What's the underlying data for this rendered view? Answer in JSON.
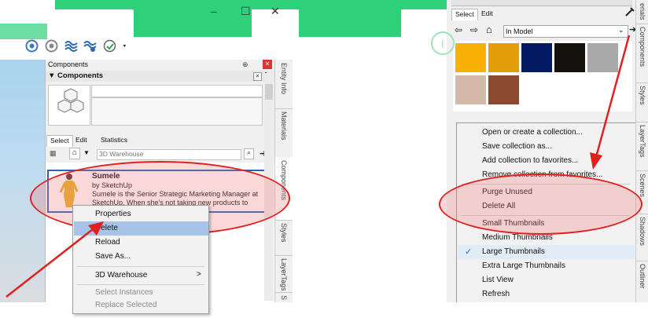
{
  "left": {
    "window_controls": {
      "minimize": "–",
      "maximize": "☐",
      "close": "✕"
    },
    "toolbar_icons": [
      "warehouse-icon",
      "warehouse-share-icon",
      "extension-icon",
      "extension-manager-icon",
      "profile-icon",
      "dropdown-arrow-icon"
    ],
    "tray": {
      "title": "Components",
      "pin": "⊕",
      "close": "✕",
      "section_title": "▼ Components",
      "tabs": [
        "Select",
        "Edit",
        "Statistics"
      ],
      "search_placeholder": "3D Warehouse",
      "component": {
        "name": "Sumele",
        "author": "by SketchUp",
        "description": "Sumele is the Senior Strategic Marketing Manager at SketchUp. When she's not taking new products to lau..."
      }
    },
    "side_tabs": [
      "Entity Info",
      "Materials",
      "Components",
      "Styles",
      "LayerTags",
      "S"
    ],
    "context_menu": {
      "items": [
        "Properties",
        "Delete",
        "Reload",
        "Save As...",
        "3D Warehouse",
        "Select Instances",
        "Replace Selected"
      ],
      "highlighted": "Delete",
      "submenu_arrow": ">"
    }
  },
  "right": {
    "tabs": [
      "Select",
      "Edit"
    ],
    "collection": "In Model",
    "swatch_colors": [
      "#f8b107",
      "#e39c0a",
      "#041a63",
      "#14100c",
      "#a9a9a9",
      "#d4b8a9",
      "#8b4a30"
    ],
    "menu_items": [
      "Open or create a collection...",
      "Save collection as...",
      "Add collection to favorites...",
      "Remove collection from favorites...",
      "Purge Unused",
      "Delete All",
      "Small Thumbnails",
      "Medium Thumbnails",
      "Large Thumbnails",
      "Extra Large Thumbnails",
      "List View",
      "Refresh"
    ],
    "checked_item": "Large Thumbnails",
    "side_tabs": [
      "erials",
      "Components",
      "Styles",
      "LayerTags",
      "Scenes",
      "Shadows",
      "Outliner"
    ]
  },
  "annotation_color": "#e22020",
  "accent_green": "#2fd07a"
}
